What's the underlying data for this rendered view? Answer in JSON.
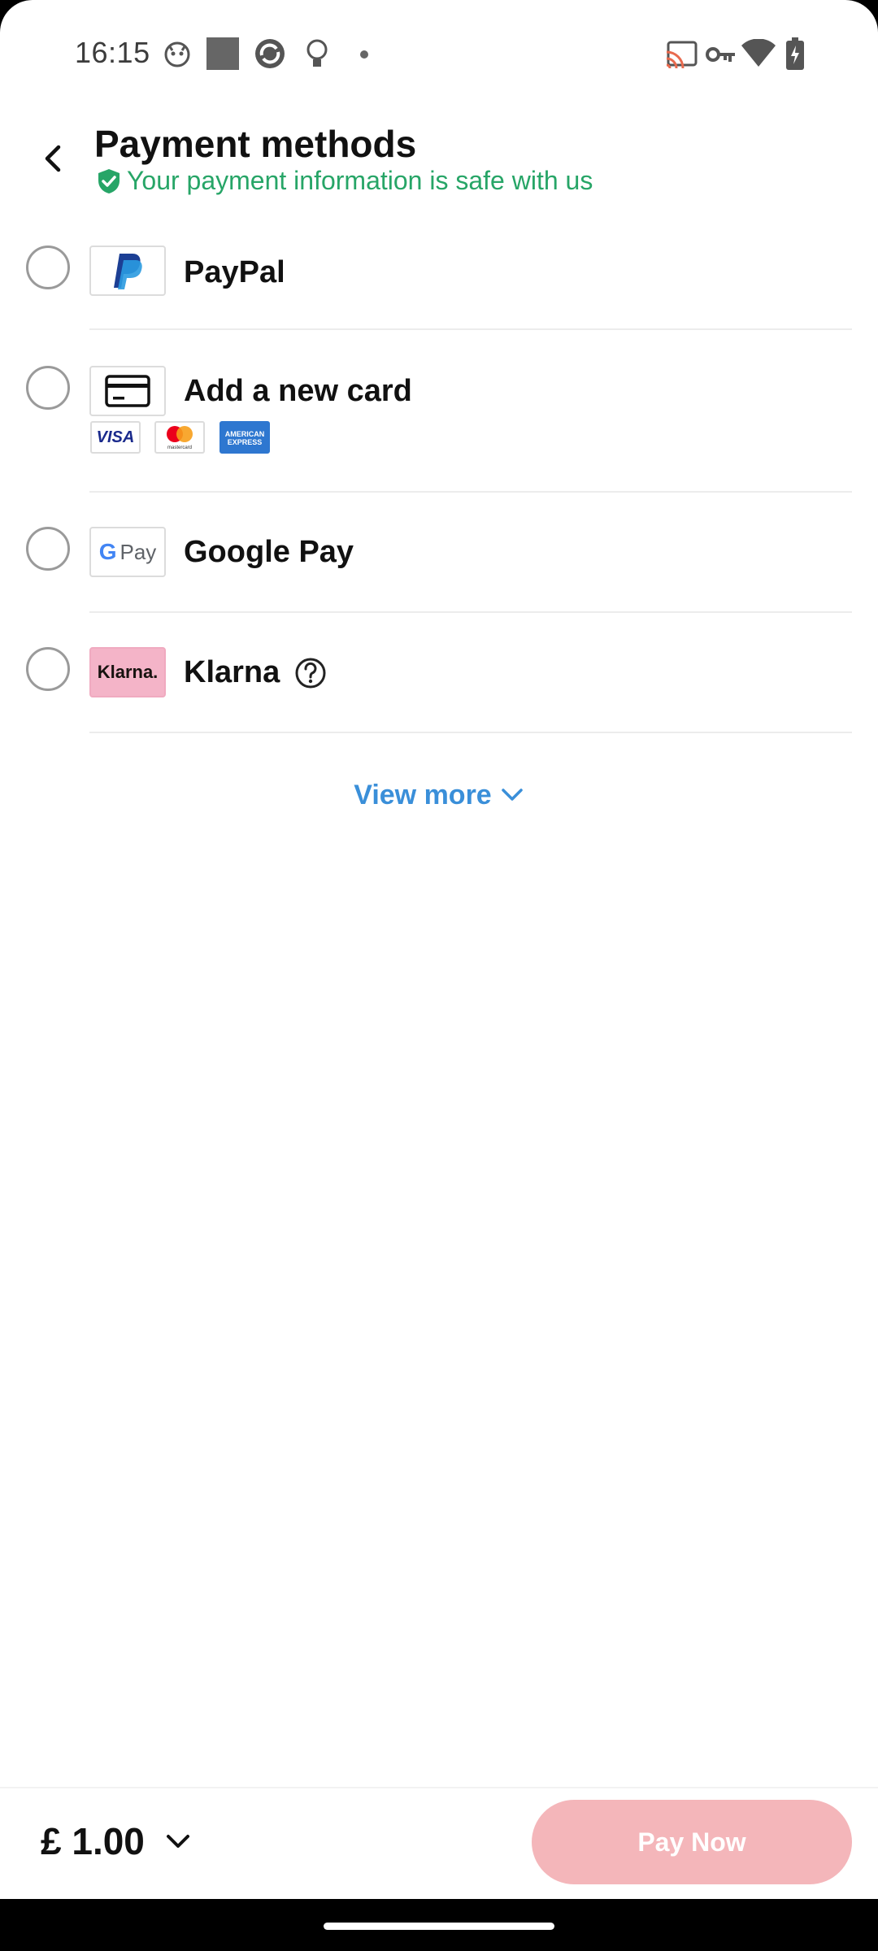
{
  "status_bar": {
    "time": "16:15"
  },
  "header": {
    "title": "Payment methods",
    "safe_note": "Your payment information is safe with us"
  },
  "payment_methods": [
    {
      "label": "PayPal",
      "logo": "paypal-logo"
    },
    {
      "label": "Add a new card",
      "logo": "credit-card-icon",
      "brands": [
        "VISA",
        "mastercard",
        "AMERICAN EXPRESS"
      ]
    },
    {
      "label": "Google Pay",
      "logo": "gpay-logo",
      "logo_text": "Pay"
    },
    {
      "label": "Klarna",
      "logo": "klarna-logo",
      "logo_text": "Klarna."
    }
  ],
  "view_more": "View more",
  "footer": {
    "price": "£ 1.00",
    "pay_button": "Pay Now"
  },
  "colors": {
    "accent_green": "#27a567",
    "link_blue": "#3a8fd9",
    "pay_button_disabled": "#f4b6ba",
    "klarna_pink": "#f4b4c8"
  }
}
